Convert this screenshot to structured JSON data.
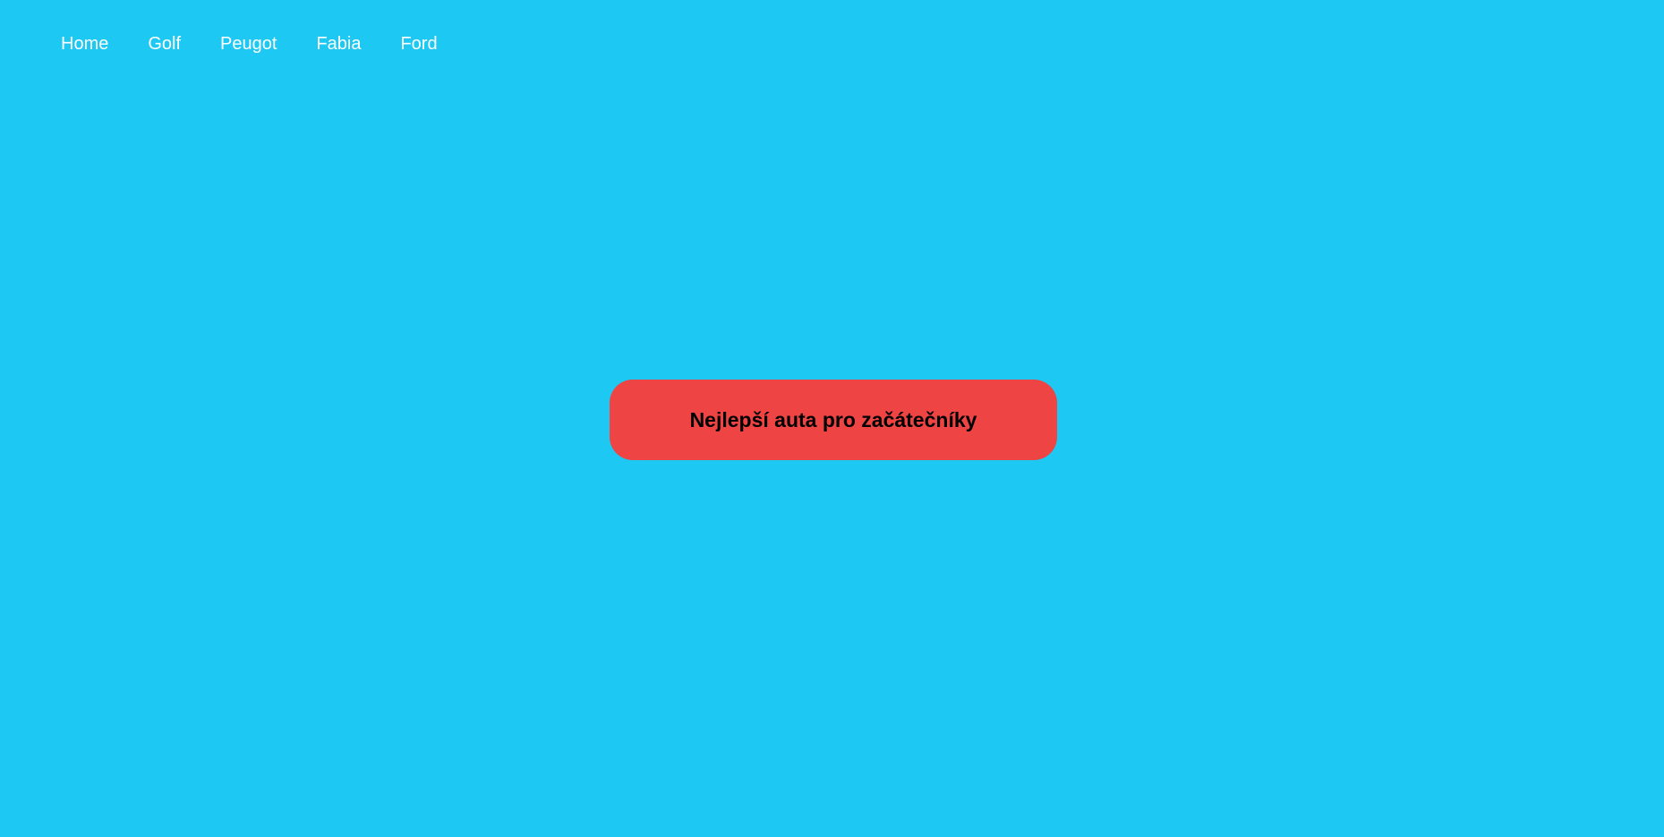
{
  "nav": {
    "items": [
      {
        "label": "Home"
      },
      {
        "label": "Golf"
      },
      {
        "label": "Peugot"
      },
      {
        "label": "Fabia"
      },
      {
        "label": "Ford"
      }
    ]
  },
  "hero": {
    "button_label": "Nejlepší auta pro začátečníky"
  },
  "colors": {
    "background": "#1dc8f2",
    "button": "#ef4444",
    "nav_text": "#ffffff",
    "button_text": "#000000"
  }
}
